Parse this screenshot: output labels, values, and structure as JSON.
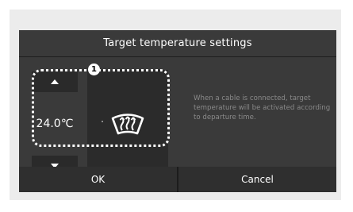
{
  "dialog": {
    "title": "Target temperature settings",
    "temperature": "24.0℃",
    "info_text": "When a cable is connected, target temperature will be activated according to departure time.",
    "callout_number": "1",
    "ok_label": "OK",
    "cancel_label": "Cancel"
  },
  "icons": {
    "up": "triangle-up",
    "down": "triangle-down",
    "heater": "windshield-defroster"
  },
  "colors": {
    "dialog_bg": "#3a3a3a",
    "button_bg": "#2b2b2b",
    "text": "#ffffff",
    "secondary_text": "#8a8a8a"
  }
}
